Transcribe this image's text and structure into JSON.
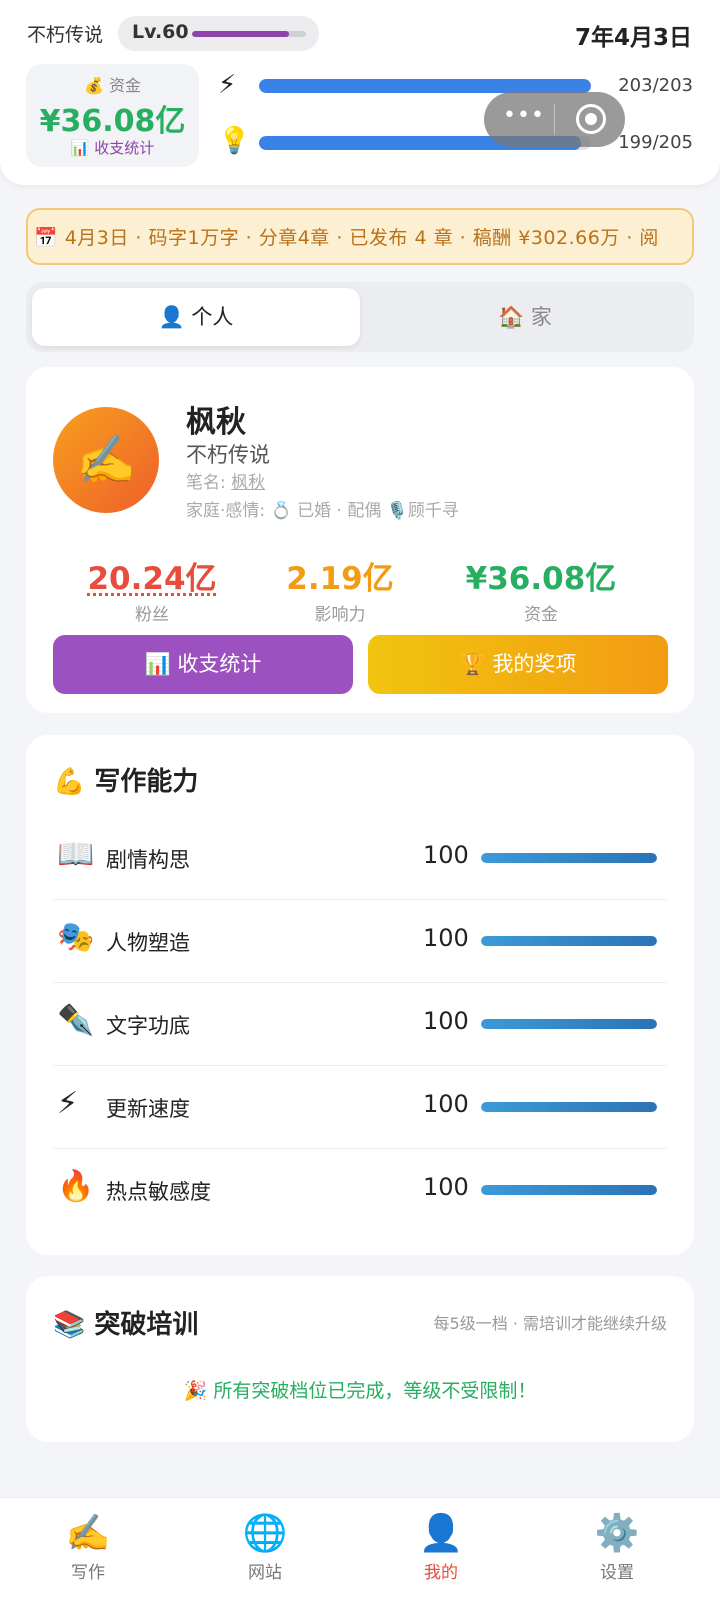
{
  "header": {
    "title": "不朽传说",
    "level": "Lv.60",
    "level_progress": 0.85,
    "date": "7年4月3日",
    "fund_label": "💰 资金",
    "fund_value": "¥36.08亿",
    "fund_link": "📊 收支统计",
    "energy_icon": "⚡",
    "energy_text": "203/203",
    "energy_ratio": 1.0,
    "idea_icon": "💡",
    "idea_text": "199/205",
    "idea_ratio": 0.97,
    "capsule_menu_icon": "•••"
  },
  "banner": {
    "text": "📅 4月3日 · 码字1万字 · 分章4章 · 已发布 4 章 · 稿酬 ¥302.66万 · 阅"
  },
  "tabs": [
    {
      "label": "👤 个人",
      "active": true
    },
    {
      "label": "🏠 家",
      "active": false
    }
  ],
  "profile": {
    "avatar_icon": "✍️",
    "name": "枫秋",
    "subtitle": "不朽传说",
    "pen_label": "笔名:",
    "pen_name": "枫秋",
    "family_label": "家庭·感情:",
    "family_value": "💍 已婚 · 配偶 🎙️顾千寻",
    "metrics": [
      {
        "value": "20.24亿",
        "label": "粉丝",
        "color": "#e74c3c"
      },
      {
        "value": "2.19亿",
        "label": "影响力",
        "color": "#f39c12"
      },
      {
        "value": "¥36.08亿",
        "label": "资金",
        "color": "#27ae60"
      }
    ],
    "btn_stats": "📊 收支统计",
    "btn_awards": "🏆 我的奖项"
  },
  "skills": {
    "title": "💪 写作能力",
    "items": [
      {
        "icon": "📖",
        "name": "剧情构思",
        "value": "100",
        "ratio": 1.0
      },
      {
        "icon": "🎭",
        "name": "人物塑造",
        "value": "100",
        "ratio": 1.0
      },
      {
        "icon": "✒️",
        "name": "文字功底",
        "value": "100",
        "ratio": 1.0
      },
      {
        "icon": "⚡",
        "name": "更新速度",
        "value": "100",
        "ratio": 1.0
      },
      {
        "icon": "🔥",
        "name": "热点敏感度",
        "value": "100",
        "ratio": 1.0
      }
    ]
  },
  "training": {
    "title": "📚 突破培训",
    "note": "每5级一档 · 需培训才能继续升级",
    "done": "🎉 所有突破档位已完成，等级不受限制！"
  },
  "nav": [
    {
      "icon": "✍️",
      "label": "写作",
      "active": false
    },
    {
      "icon": "🌐",
      "label": "网站",
      "active": false
    },
    {
      "icon": "👤",
      "label": "我的",
      "active": true
    },
    {
      "icon": "⚙️",
      "label": "设置",
      "active": false
    }
  ],
  "colors": {
    "accent_purple": "#8e44ad",
    "money_green": "#27ae60",
    "bar_blue": "#3b82e6",
    "nav_active": "#e74c3c"
  }
}
